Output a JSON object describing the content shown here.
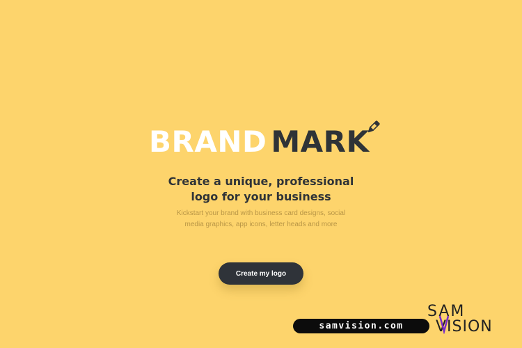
{
  "brand": {
    "word_light": "BRAND",
    "word_dark": "MARK"
  },
  "hero": {
    "headline_line1": "Create a unique, professional",
    "headline_line2": "logo for your business",
    "sub_line1": "Kickstart your brand with business card designs, social",
    "sub_line2": "media graphics, app icons, letter heads and more"
  },
  "cta": {
    "label": "Create my logo"
  },
  "watermark": {
    "url": "samvision.com",
    "logo_top": "SAM",
    "logo_bottom": "VISION"
  },
  "colors": {
    "background": "#fdd46c",
    "dark": "#2f3337",
    "light": "#ffffff",
    "muted": "#b99646",
    "watermark_accent": "#7a2cc8"
  },
  "icons": {
    "brand_mark": "pen-icon"
  }
}
